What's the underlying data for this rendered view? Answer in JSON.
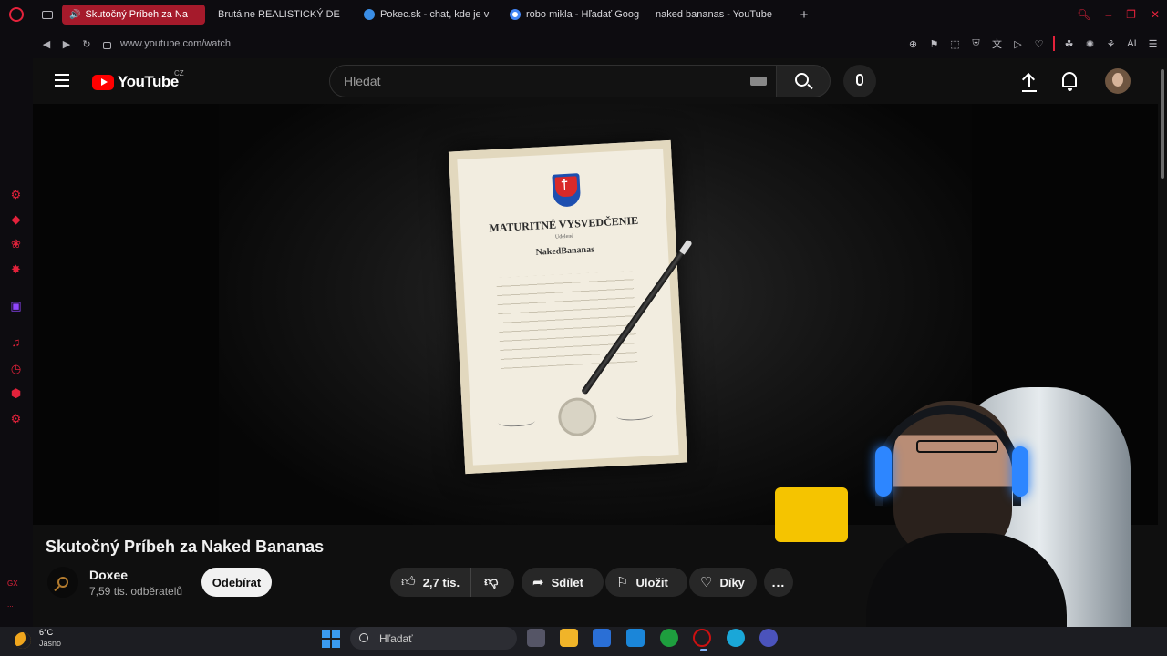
{
  "browser": {
    "tabs": [
      {
        "label": "Skutočný Príbeh za Na",
        "active": true,
        "favicon": "youtube-icon",
        "audio": true
      },
      {
        "label": "Brutálne REALISTICKÝ DE",
        "active": false,
        "favicon": "youtube-icon"
      },
      {
        "label": "Pokec.sk - chat, kde je v",
        "active": false,
        "favicon": "pokec-icon"
      },
      {
        "label": "robo mikla - Hľadať Goog",
        "active": false,
        "favicon": "google-icon"
      },
      {
        "label": "naked bananas - YouTube",
        "active": false,
        "favicon": "youtube-icon"
      }
    ],
    "new_tab": "+",
    "url": "www.youtube.com/watch",
    "accent_color": "#e3223b",
    "sidebar_bottom_label": "GX",
    "sidebar_more": "..."
  },
  "youtube": {
    "logo_text": "YouTube",
    "country_code": "CZ",
    "search_placeholder": "Hledat",
    "video": {
      "title": "Skutočný Príbeh za Naked Bananas",
      "likes": "2,7 tis.",
      "share_label": "Sdílet",
      "save_label": "Uložit",
      "thanks_label": "Díky",
      "more_label": "..."
    },
    "channel": {
      "name": "Doxee",
      "subscribers": "7,59 tis. odběratelů",
      "subscribe_label": "Odebírat"
    },
    "thumbnail": {
      "heading": "MATURITNÉ VYSVEDČENIE",
      "small": "Udelené",
      "name": "NakedBananas"
    }
  },
  "taskbar": {
    "temperature": "6°C",
    "condition": "Jasno",
    "search_label": "Hľadať"
  }
}
